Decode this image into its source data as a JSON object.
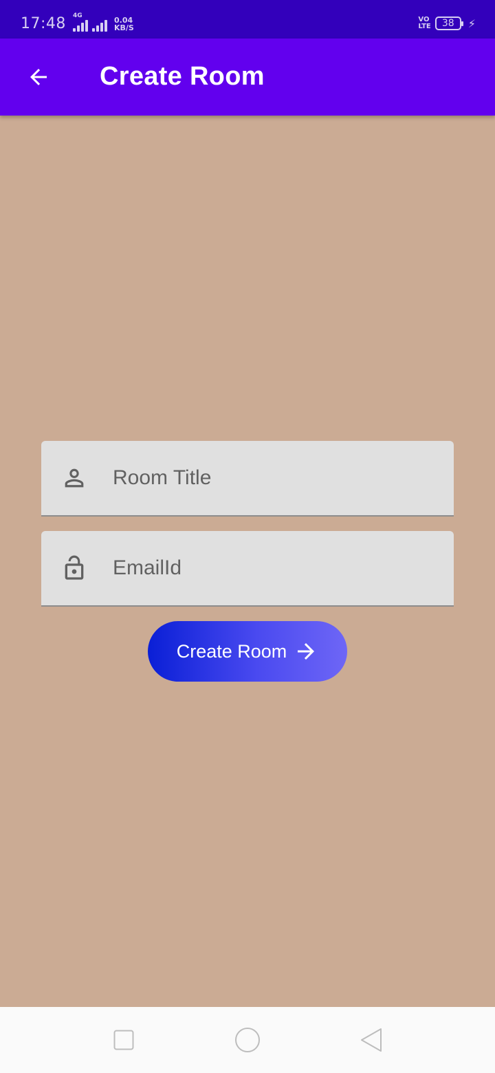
{
  "status_bar": {
    "time": "17:48",
    "network_type": "4G",
    "net_speed_value": "0.04",
    "net_speed_unit": "KB/S",
    "volte_top": "VO",
    "volte_bottom": "LTE",
    "battery_level": "38"
  },
  "app_bar": {
    "title": "Create Room",
    "back_icon": "arrow-left-icon"
  },
  "form": {
    "room_title": {
      "placeholder": "Room Title",
      "value": "",
      "icon": "person-icon"
    },
    "email": {
      "placeholder": "EmailId",
      "value": "",
      "icon": "lock-icon"
    },
    "submit_label": "Create Room",
    "submit_icon": "arrow-right-icon"
  },
  "nav_bar": {
    "recents_icon": "square-icon",
    "home_icon": "circle-icon",
    "back_icon": "triangle-back-icon"
  },
  "colors": {
    "status_bar": "#3300BB",
    "app_bar": "#6200EE",
    "background": "#CBAB94",
    "field": "#E0E0E0",
    "button_start": "#0A1FD6",
    "button_end": "#6E66F6"
  }
}
